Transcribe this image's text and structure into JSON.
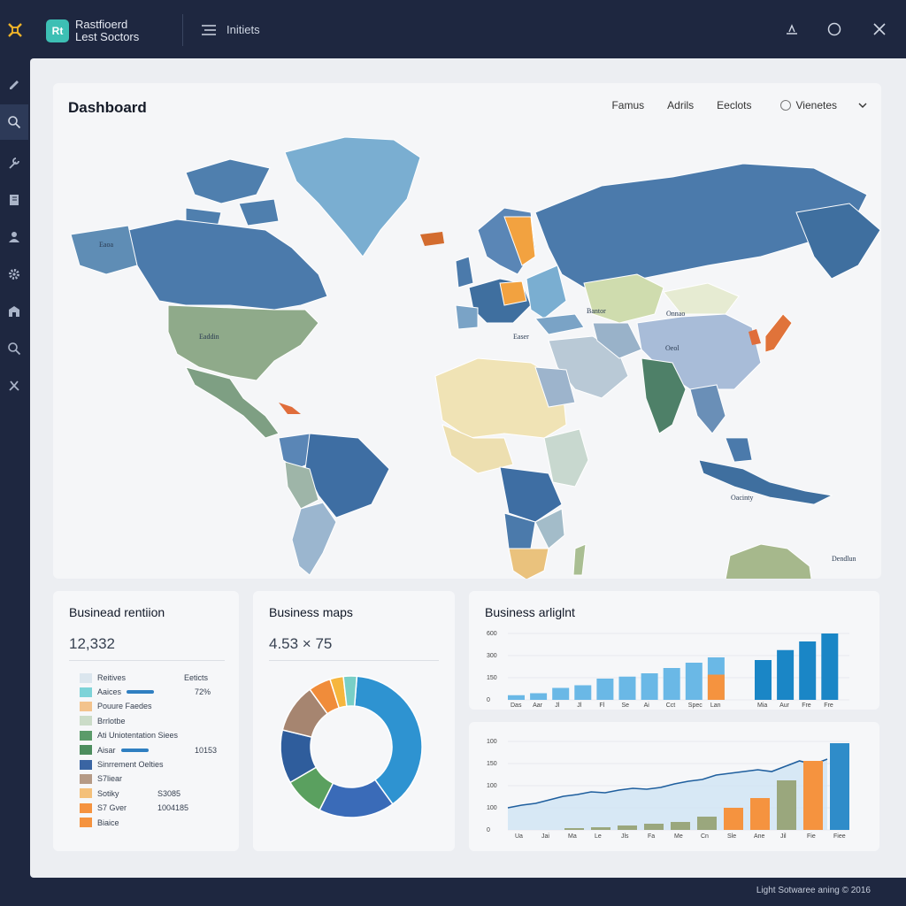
{
  "app": {
    "name": "Rastfioerd\nLest Soctors",
    "badge": "Rt",
    "menu_label": "Initiets"
  },
  "sidebar": {
    "items": [
      {
        "icon": "pencil-icon"
      },
      {
        "icon": "search-icon",
        "active": true
      },
      {
        "icon": "wrench-icon"
      },
      {
        "icon": "book-icon"
      },
      {
        "icon": "user-icon"
      },
      {
        "icon": "gear-icon"
      },
      {
        "icon": "building-icon"
      },
      {
        "icon": "search-icon"
      },
      {
        "icon": "tools-icon"
      }
    ]
  },
  "dashboard": {
    "title": "Dashboard",
    "tabs": [
      "Famus",
      "Adrils",
      "Eeclots"
    ],
    "views_label": "Vienetes",
    "map_labels": {
      "north_america": "Eaoa",
      "usa": "Eaddin",
      "asia": "Bantor",
      "mongolia": "Onnao",
      "china": "Oeol",
      "middle_east": "Easer",
      "australia": "Oacinty",
      "nz": "Dendlun"
    }
  },
  "cards": {
    "retention": {
      "title": "Businead rentiion",
      "value": "12,332",
      "legend_head_left": "Reitives",
      "legend_head_right": "Eeticts",
      "rows": [
        {
          "label": "Aaices",
          "color": "#7dd3d8",
          "bar": 0.5,
          "value": "72%"
        },
        {
          "label": "Pouure Faedes",
          "color": "#f3c38d"
        },
        {
          "label": "Brrlotbe",
          "color": "#cbdcc8"
        },
        {
          "label": "Ati Uniotentation Siees",
          "color": "#5b9b6a"
        },
        {
          "label": "Aisar",
          "color": "#4c8d5e",
          "bar": 0.5,
          "value": "10153"
        },
        {
          "label": "Sinrrement Oelties",
          "color": "#3a65a3"
        },
        {
          "label": "S7liear",
          "color": "#b59a86"
        },
        {
          "label": "Sotiky",
          "color": "#f4c07a",
          "value": "S3085"
        },
        {
          "label": "S7 Gver",
          "color": "#f5933f",
          "value": "1004185"
        },
        {
          "label": "Biaice",
          "color": "#f5933f"
        }
      ]
    },
    "maps": {
      "title": "Business maps",
      "value": "4.53 × 75"
    },
    "insight": {
      "title": "Business arliglnt"
    },
    "footer": "Light Sotwaree aning © 2016"
  },
  "chart_data": [
    {
      "type": "pie",
      "title": "",
      "labels": [
        "",
        "",
        "",
        "",
        "",
        "",
        "",
        ""
      ],
      "values": [
        38,
        17,
        9,
        12,
        11,
        5,
        3,
        3
      ],
      "colors": [
        "#2e93d1",
        "#3a6bb8",
        "#5aa05f",
        "#2f5d9c",
        "#a68570",
        "#f08c3a",
        "#f6b63e",
        "#79cfc6"
      ]
    },
    {
      "type": "bar",
      "title": "Business arliglnt",
      "yticks": [
        "600",
        "300",
        "150",
        "0"
      ],
      "categories": [
        "Das",
        "Aar",
        "Jl",
        "Jl",
        "Fl",
        "Se",
        "Ai",
        "Cct",
        "Spec",
        "Lan",
        "Mia",
        "Aur",
        "Fre",
        "Fre"
      ],
      "values": [
        7,
        10,
        18,
        22,
        32,
        35,
        40,
        48,
        56,
        64,
        60,
        75,
        88,
        100
      ],
      "stack_orange": [
        0,
        0,
        0,
        0,
        0,
        0,
        0,
        0,
        0,
        38,
        0,
        0,
        0,
        0
      ],
      "colors": [
        "#6ab8e6",
        "#6ab8e6",
        "#6ab8e6",
        "#6ab8e6",
        "#6ab8e6",
        "#6ab8e6",
        "#6ab8e6",
        "#6ab8e6",
        "#6ab8e6",
        "#6ab8e6",
        "#1a86c6",
        "#1a86c6",
        "#1a86c6",
        "#1a86c6"
      ]
    },
    {
      "type": "bar",
      "title": "",
      "yticks": [
        "100",
        "150",
        "100",
        "100",
        "0"
      ],
      "categories": [
        "Ua",
        "Jai",
        "Ma",
        "Le",
        "Jls",
        "Fa",
        "Me",
        "Cn",
        "Sle",
        "Ane",
        "Jil",
        "Fie",
        "Fiee"
      ],
      "values": [
        0,
        0,
        0,
        2,
        3,
        5,
        7,
        9,
        15,
        25,
        36,
        56,
        78,
        98
      ],
      "colors": [
        "#9aa77d",
        "#9aa77d",
        "#9aa77d",
        "#9aa77d",
        "#9aa77d",
        "#9aa77d",
        "#9aa77d",
        "#9aa77d",
        "#f5933f",
        "#f5933f",
        "#9aa77d",
        "#f5933f",
        "#2f8cc9"
      ],
      "line": [
        25,
        28,
        30,
        34,
        38,
        40,
        43,
        42,
        45,
        47,
        46,
        48,
        52,
        55,
        57,
        62,
        64,
        66,
        68,
        66,
        72,
        78,
        74,
        80
      ]
    }
  ]
}
